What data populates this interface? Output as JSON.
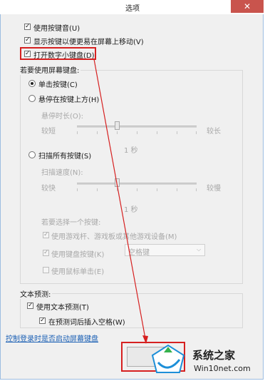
{
  "window": {
    "title": "选项",
    "close_glyph": "✕"
  },
  "checkboxes_top": [
    {
      "label": "使用按键音(U)",
      "checked": true
    },
    {
      "label": "显示按键以便更易在屏幕上移动(V)",
      "checked": true
    },
    {
      "label": "打开数字小键盘(D)",
      "checked": true
    }
  ],
  "screen_keyboard": {
    "heading": "若要使用屏幕键盘:",
    "option_click": "单击按键(C)",
    "option_hover": "悬停在按键上方(H)",
    "hover_duration_label": "悬停时长(O):",
    "hover_short": "较短",
    "hover_long": "较长",
    "hover_value": "1 秒",
    "option_scan": "扫描所有按键(S)",
    "scan_speed_label": "扫描速度(N):",
    "scan_fast": "较快",
    "scan_slow": "较慢",
    "scan_value": "1 秒",
    "select_key_label": "若要选择一个按键:",
    "use_joystick": "使用游戏杆、游戏板或其他游戏设备(M)",
    "use_keyboard_key": "使用键盘按键(K)",
    "key_combo_value": "空格键",
    "use_mouse_click": "使用鼠标单击(E)"
  },
  "text_prediction": {
    "heading": "文本预测:",
    "use_prediction": "使用文本预测(T)",
    "insert_space": "在预测词后插入空格(W)"
  },
  "startup_link": "控制登录时是否启动屏幕键盘",
  "watermark": {
    "brand": "系统之家",
    "site": "Win10net.com"
  },
  "colors": {
    "annotation_red": "#d62020",
    "close_red": "#c9544d",
    "link_blue": "#1a5fb4"
  }
}
